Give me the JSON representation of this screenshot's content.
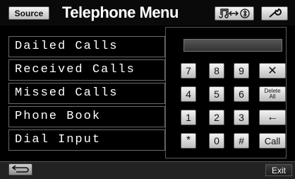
{
  "header": {
    "source_label": "Source",
    "title": "Telephone Menu",
    "mode_button": "music-bluetooth-icon",
    "tool_button": "wrench-icon"
  },
  "menu": {
    "items": [
      {
        "label": "Dailed Calls"
      },
      {
        "label": "Received Calls"
      },
      {
        "label": "Missed Calls"
      },
      {
        "label": "Phone Book"
      },
      {
        "label": "Dial Input"
      }
    ]
  },
  "dialpad": {
    "display_value": "",
    "keys": [
      "7",
      "8",
      "9",
      "4",
      "5",
      "6",
      "1",
      "2",
      "3",
      "*",
      "0",
      "#"
    ],
    "clear_label": "✕",
    "delete_all_line1": "Delete",
    "delete_all_line2": "All",
    "backspace_label": "←",
    "call_label": "Call"
  },
  "footer": {
    "back_icon": "return-icon",
    "exit_label": "Exit"
  }
}
